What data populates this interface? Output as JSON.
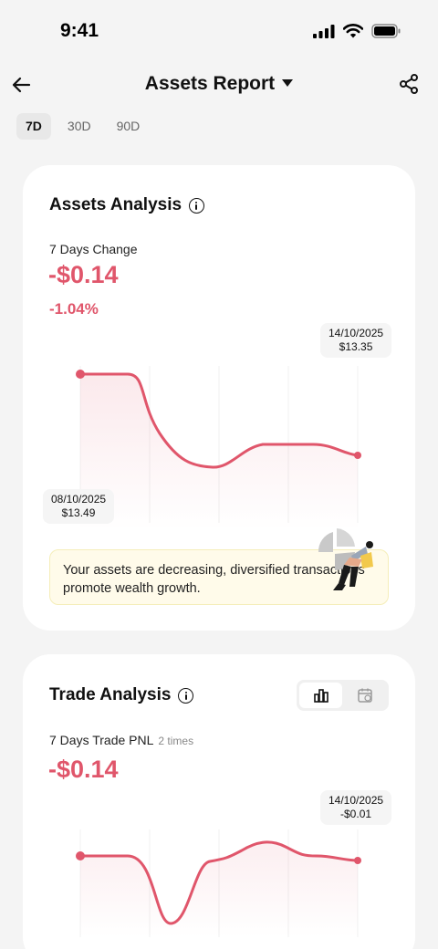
{
  "status_bar": {
    "time": "9:41"
  },
  "nav": {
    "title": "Assets Report"
  },
  "periods": [
    "7D",
    "30D",
    "90D"
  ],
  "selected_period": "7D",
  "assets_analysis": {
    "title": "Assets Analysis",
    "change_label": "7 Days Change",
    "change_value": "-$0.14",
    "change_percent": "-1.04%",
    "start_tooltip": {
      "date": "08/10/2025",
      "value": "$13.49"
    },
    "end_tooltip": {
      "date": "14/10/2025",
      "value": "$13.35"
    },
    "notice": "Your assets are decreasing, diversified transactions promote wealth growth."
  },
  "trade_analysis": {
    "title": "Trade Analysis",
    "pnl_label": "7 Days Trade PNL",
    "pnl_times": "2 times",
    "pnl_value": "-$0.14",
    "end_tooltip": {
      "date": "14/10/2025",
      "value": "-$0.01"
    }
  },
  "colors": {
    "accent": "#e0566b",
    "background": "#f4f4f4",
    "card": "#ffffff",
    "notice_bg": "#fffbea"
  }
}
